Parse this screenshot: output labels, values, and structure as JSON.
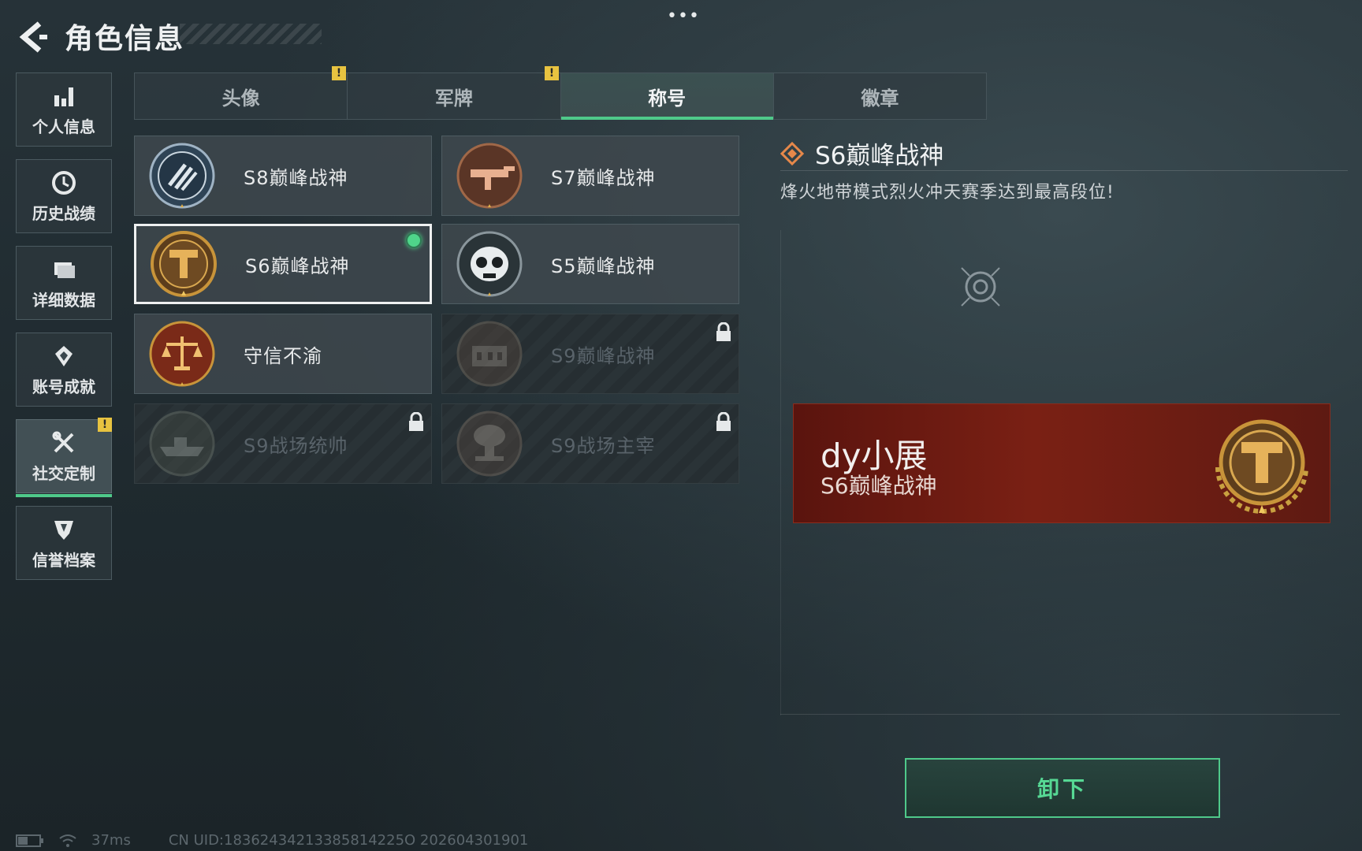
{
  "header": {
    "title": "角色信息",
    "menu": "•••"
  },
  "nav": [
    {
      "label": "个人信息",
      "icon": "bar-chart-icon"
    },
    {
      "label": "历史战绩",
      "icon": "clock-icon"
    },
    {
      "label": "详细数据",
      "icon": "folder-icon"
    },
    {
      "label": "账号成就",
      "icon": "medal-icon"
    },
    {
      "label": "社交定制",
      "icon": "tools-icon",
      "active": true,
      "badge": "!"
    },
    {
      "label": "信誉档案",
      "icon": "shield-icon"
    }
  ],
  "tabs": [
    {
      "label": "头像",
      "badge": "!"
    },
    {
      "label": "军牌",
      "badge": "!"
    },
    {
      "label": "称号",
      "active": true
    },
    {
      "label": "徽章"
    }
  ],
  "titles": [
    {
      "name": "S8巅峰战神",
      "emblem": "striped-shield-emblem",
      "locked": false
    },
    {
      "name": "S7巅峰战神",
      "emblem": "rifle-emblem",
      "locked": false
    },
    {
      "name": "S6巅峰战神",
      "emblem": "t-hammer-emblem",
      "locked": false,
      "selected": true,
      "equipped": true
    },
    {
      "name": "S5巅峰战神",
      "emblem": "skull-mask-emblem",
      "locked": false
    },
    {
      "name": "守信不渝",
      "emblem": "scales-emblem",
      "locked": false
    },
    {
      "name": "S9巅峰战神",
      "emblem": "fortress-emblem",
      "locked": true
    },
    {
      "name": "S9战场统帅",
      "emblem": "battleship-emblem",
      "locked": true
    },
    {
      "name": "S9战场主宰",
      "emblem": "mushroom-cloud-emblem",
      "locked": true
    }
  ],
  "detail": {
    "title": "S6巅峰战神",
    "description": "烽火地带模式烈火冲天赛季达到最高段位!",
    "banner_name": "dy小展",
    "banner_title": "S6巅峰战神",
    "button_label": "卸下"
  },
  "footer": {
    "ping": "37ms",
    "uid": "CN UID:18362434213385814225O 202604301901"
  },
  "colors": {
    "accent": "#4fc98a",
    "banner": "#7a2014",
    "badge": "#e8c340",
    "emblem_gold": "#c8943a"
  }
}
